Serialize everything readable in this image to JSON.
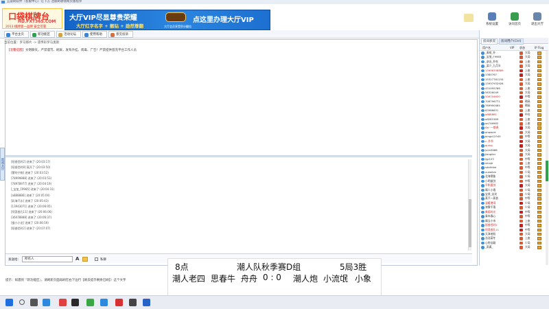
{
  "window": {
    "title": "五雷刷软件（客服中心）在下方 注册刷收钱网页版程序"
  },
  "logo": {
    "line1": "口袋棋牌台",
    "line2": "HD.FXT365.COM",
    "line3": "2013 棋牌第一品牌 安全可靠"
  },
  "vip_banner": {
    "title": "大厅VIP尽显尊贵荣耀",
    "subtitle": "大厅红字名字 + 靓钻 + 勋然尊翻",
    "right_title": "点这里办理大厅VIP",
    "small_text": "大厅会员享受积分翻倍"
  },
  "top_buttons": [
    {
      "label": "系统设置",
      "color": "#5a7fb8"
    },
    {
      "label": "访问首页",
      "color": "#3a9d4e"
    },
    {
      "label": "退出大厅",
      "color": "#6a86a8"
    }
  ],
  "nav_tabs": [
    {
      "label": "平台主页",
      "color": "#3a86d4"
    },
    {
      "label": "新功能区",
      "color": "#2ea24c"
    },
    {
      "label": "活动论坛",
      "color": "#d2a440"
    },
    {
      "label": "使用帮助",
      "color": "#3a86d4"
    },
    {
      "label": "意见投诉",
      "color": "#d27040"
    }
  ],
  "breadcrumb": "当前位置：罗马那片  ->  遗传形罗马奥斯",
  "notice": {
    "tag": "【温馨提醒】",
    "text": "文明聊天，严禁谩骂、刷屏，发布外挂、病毒、广告！严禁提供冒充平台工作人员"
  },
  "side_tab": "新闻大厅",
  "chat_log": [
    "[阳香侣时2] 进来了 (20:03:17)",
    "[阳香侣时8] 离开了 (20:03:50)",
    "[蒙的宁物] 进来了 (20:03:52)",
    "[78999888] 进来了 (20:03:53)",
    "[78978977] 进来了 (20:04:19)",
    "[_宝玺_F9985] 进来了 (20:04:31)",
    "[a8888B6] 进来了 (20:05:00)",
    "[彩海汽水] 进来了 (20:05:43)",
    "[13943071] 进来了 (20:06:05)",
    "[阿莲香孔11] 进来了 (20:06:06)",
    "[36478888] 进来了 (20:06:37)",
    "[蚕小小龙] 进来了 (20:06:59)",
    "[阳香侣时2] 进来了 (20:07:07)"
  ],
  "input_bar": {
    "label": "发送给：",
    "target": "所有人",
    "checkbox": "私聊"
  },
  "tip": "提示：如遇到『新功能区』，请刷新页面再刷在右下边行【刷去提示剩余已刷】）这个文字",
  "right_panel": {
    "tabs": [
      "房间状况",
      "房间用户(Ctrl)"
    ],
    "headers": [
      "用户名",
      "VIP",
      "状态",
      "IP Flag"
    ],
    "users": [
      {
        "name": "_青栀_扑",
        "av": "#3b8fd9",
        "vip": "#d85a30",
        "state": "大局"
      },
      {
        "name": "_宝玺_F9985",
        "av": "#3b8fd9",
        "vip": "#d85a30",
        "state": "大局"
      },
      {
        "name": "_拿出_扑吃",
        "av": "#3b8fd9",
        "vip": "#d85a30",
        "state": "上座"
      },
      {
        "name": "_梁少_九月半",
        "av": "#3b8fd9",
        "vip": "#d85a30",
        "state": "大局"
      },
      {
        "name": "13906338889",
        "av": "#3b8fd9",
        "vip": "#c42020",
        "state": "上座",
        "red": true
      },
      {
        "name": "1384767",
        "av": "#3b8fd9",
        "vip": "#c42020",
        "state": "大局"
      },
      {
        "name": "15327781234",
        "av": "#3b8fd9",
        "vip": "#d85a30",
        "state": "上座"
      },
      {
        "name": "13937932928",
        "av": "#3b8fd9",
        "vip": "#d85a30",
        "state": "大局"
      },
      {
        "name": "431095788",
        "av": "#3b8fd9",
        "vip": "#d85a30",
        "state": "上座"
      },
      {
        "name": "56326049",
        "av": "#3b8fd9",
        "vip": "#d85a30",
        "state": "大局"
      },
      {
        "name": "556794650",
        "av": "#3b8fd9",
        "vip": "#c42020",
        "state": "中等",
        "red": true
      },
      {
        "name": "706796771",
        "av": "#3b8fd9",
        "vip": "#d85a30",
        "state": "朝高"
      },
      {
        "name": "769990484",
        "av": "#3b8fd9",
        "vip": "#d85a30",
        "state": "朝高"
      },
      {
        "name": "83966631",
        "av": "#3b8fd9",
        "vip": "#d85a30",
        "state": "上座"
      },
      {
        "name": "a8888B1",
        "av": "#3b8fd9",
        "vip": "#c42020",
        "state": "中台",
        "red": true
      },
      {
        "name": "a8281589",
        "av": "#3b8fd9",
        "vip": "#d85a30",
        "state": "上座"
      },
      {
        "name": "aa746982",
        "av": "#3b8fd9",
        "vip": "#d85a30",
        "state": "上座"
      },
      {
        "name": "Aa~一都贵",
        "av": "#3b8fd9",
        "vip": "#c42020",
        "state": "大局",
        "red": true
      },
      {
        "name": "ahqwert",
        "av": "#3b8fd9",
        "vip": "#d85a30",
        "state": "大局"
      },
      {
        "name": "bingo12345",
        "av": "#3b8fd9",
        "vip": "#d85a30",
        "state": "中等"
      },
      {
        "name": "c..扑扑",
        "av": "#3b8fd9",
        "vip": "#c42020",
        "state": "大局",
        "red": true
      },
      {
        "name": "guing",
        "av": "#3b8fd9",
        "vip": "#c42020",
        "state": "大局",
        "red": true
      },
      {
        "name": "julin5666",
        "av": "#3b8fd9",
        "vip": "#d85a30",
        "state": "大局"
      },
      {
        "name": "Jianglier",
        "av": "#3b8fd9",
        "vip": "#d85a30",
        "state": "大局"
      },
      {
        "name": "ljgl123",
        "av": "#3b8fd9",
        "vip": "#d85a30",
        "state": "中等"
      },
      {
        "name": "shiaje",
        "av": "#3b8fd9",
        "vip": "#d85a30",
        "state": "上座"
      },
      {
        "name": "sdahhbe",
        "av": "#3b8fd9",
        "vip": "#d85a30",
        "state": "中等"
      },
      {
        "name": "xuealbin",
        "av": "#3b8fd9",
        "vip": "#d85a30",
        "state": "少局"
      },
      {
        "name": "北海德鲁",
        "av": "#3b8fd9",
        "vip": "#d85a30",
        "state": "少局"
      },
      {
        "name": "小明量剑",
        "av": "#3b8fd9",
        "vip": "#d85a30",
        "state": "中等"
      },
      {
        "name": "平和喜剑",
        "av": "#3b8fd9",
        "vip": "#c42020",
        "state": "大局",
        "red": true
      },
      {
        "name": "晴人小墙",
        "av": "#3b8fd9",
        "vip": "#d85a30",
        "state": "少局"
      },
      {
        "name": "宝贤_苦笑",
        "av": "#3b8fd9",
        "vip": "#d85a30",
        "state": "少局"
      },
      {
        "name": "蒸汽一蒸香",
        "av": "#3b8fd9",
        "vip": "#d85a30",
        "state": "中等"
      },
      {
        "name": "温暖港湾",
        "av": "#3b8fd9",
        "vip": "#c42020",
        "state": "少局",
        "red": true
      },
      {
        "name": "漆雾千落",
        "av": "#3b8fd9",
        "vip": "#d85a30",
        "state": "少局"
      },
      {
        "name": "美丽时光",
        "av": "#3b8fd9",
        "vip": "#c42020",
        "state": "中等",
        "red": true
      },
      {
        "name": "青市春心",
        "av": "#3b8fd9",
        "vip": "#d85a30",
        "state": "中等"
      },
      {
        "name": "晴当小市",
        "av": "#3b8fd9",
        "vip": "#d85a30",
        "state": "上座"
      },
      {
        "name": "阳香侣时2",
        "av": "#3b8fd9",
        "vip": "#c42020",
        "state": "中等",
        "red": true
      },
      {
        "name": "阿莲香孔11",
        "av": "#3b8fd9",
        "vip": "#c42020",
        "state": "中等",
        "red": true
      },
      {
        "name": "天津老船",
        "av": "#3b8fd9",
        "vip": "#d85a30",
        "state": "大局"
      },
      {
        "name": "浩浩菜冬",
        "av": "#3b8fd9",
        "vip": "#d85a30",
        "state": "上座"
      },
      {
        "name": "心悦佳靓",
        "av": "#3b8fd9",
        "vip": "#d85a30",
        "state": "少局"
      },
      {
        "name": "_雨柔_",
        "av": "#3b8fd9",
        "vip": "#d85a30",
        "state": "大局"
      }
    ]
  },
  "score_overlay": {
    "row1": [
      "8点",
      "潮人队秋季赛D组",
      "5局3胜"
    ],
    "row2": [
      "潮人老四",
      "思春牛",
      "舟舟",
      "0 : 0",
      "潮人炮",
      "小流氓",
      "小象"
    ]
  },
  "taskbar": {
    "icons": [
      {
        "name": "windows-start-icon",
        "color": "#1f6fe0"
      },
      {
        "name": "search-icon",
        "color": "#555555"
      },
      {
        "name": "task-view-icon",
        "color": "#555555"
      },
      {
        "name": "ie-icon",
        "color": "#2b8ae0"
      },
      {
        "name": "app-game-icon",
        "color": "#e04040"
      },
      {
        "name": "qq-icon",
        "color": "#2a2a2a"
      },
      {
        "name": "360-icon",
        "color": "#39a844"
      },
      {
        "name": "store-icon",
        "color": "#2b8ae0"
      },
      {
        "name": "app-red-icon",
        "color": "#d83030"
      },
      {
        "name": "app-dark-icon",
        "color": "#444444"
      },
      {
        "name": "app-blue-icon",
        "color": "#2563c9"
      }
    ]
  }
}
